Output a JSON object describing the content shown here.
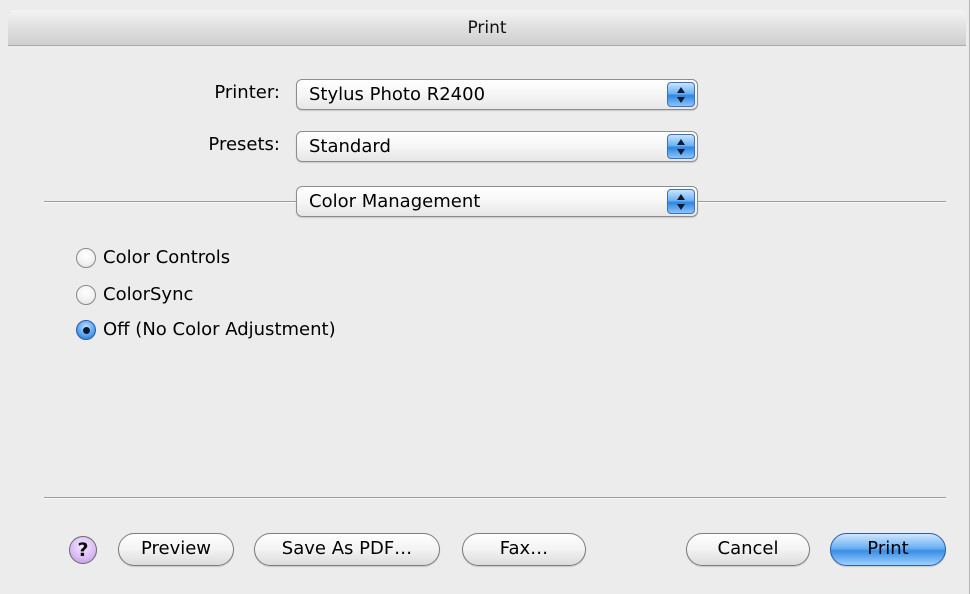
{
  "window": {
    "title": "Print"
  },
  "printer": {
    "label": "Printer:",
    "value": "Stylus Photo R2400"
  },
  "presets": {
    "label": "Presets:",
    "value": "Standard"
  },
  "panel": {
    "value": "Color Management"
  },
  "color_options": [
    {
      "label": "Color Controls",
      "selected": false
    },
    {
      "label": "ColorSync",
      "selected": false
    },
    {
      "label": "Off (No Color Adjustment)",
      "selected": true
    }
  ],
  "buttons": {
    "help": "?",
    "preview": "Preview",
    "save_pdf": "Save As PDF…",
    "fax": "Fax…",
    "cancel": "Cancel",
    "print": "Print"
  },
  "colors": {
    "accent": "#3a8ee6",
    "help_button": "#d9b8f5"
  }
}
